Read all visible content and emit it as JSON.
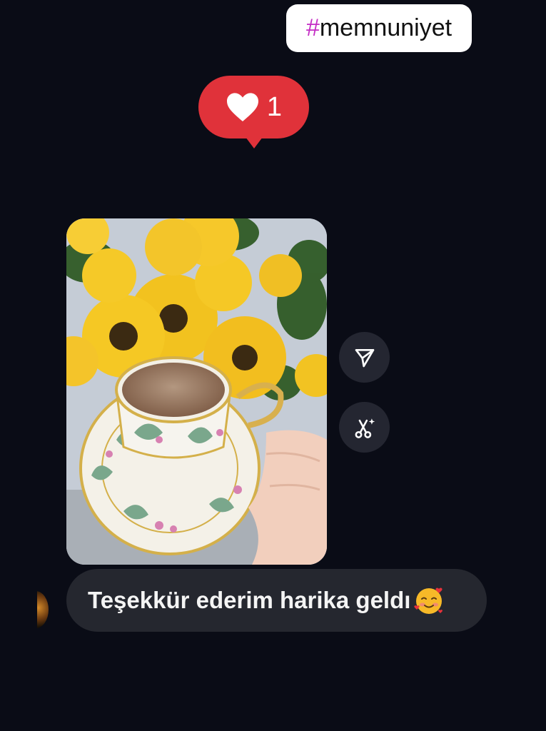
{
  "hashtag": {
    "symbol": "#",
    "text": "memnuniyet",
    "symbol_color": "#c42ec5"
  },
  "reaction": {
    "icon": "heart-icon",
    "count": "1",
    "color": "#e0323a"
  },
  "photo": {
    "alt": "Turkish coffee cup held in front of sunflowers"
  },
  "actions": [
    {
      "icon": "send-icon"
    },
    {
      "icon": "scissors-sparkle-icon"
    }
  ],
  "message": {
    "text": "Teşekkür ederim harika geldı",
    "emoji": "smiling-face-with-hearts-icon"
  },
  "avatar": {
    "icon": "avatar"
  }
}
